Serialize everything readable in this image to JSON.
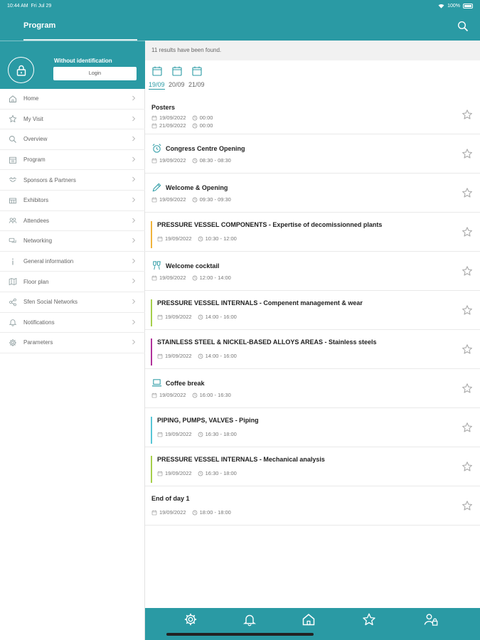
{
  "status_bar": {
    "time": "10:44 AM",
    "date": "Fri Jul 29",
    "battery": "100%"
  },
  "header": {
    "title": "Program",
    "search_icon": "search-icon"
  },
  "user_panel": {
    "identification_text": "Without identification",
    "login_label": "Login",
    "avatar_icon": "lock-icon"
  },
  "menu": {
    "items": [
      {
        "label": "Home",
        "icon": "home-icon"
      },
      {
        "label": "My Visit",
        "icon": "star-icon"
      },
      {
        "label": "Overview",
        "icon": "search-icon"
      },
      {
        "label": "Program",
        "icon": "program-icon"
      },
      {
        "label": "Sponsors & Partners",
        "icon": "handshake-icon"
      },
      {
        "label": "Exhibitors",
        "icon": "exhibitors-icon"
      },
      {
        "label": "Attendees",
        "icon": "attendees-icon"
      },
      {
        "label": "Networking",
        "icon": "chat-icon"
      },
      {
        "label": "General information",
        "icon": "info-icon"
      },
      {
        "label": "Floor plan",
        "icon": "map-icon"
      },
      {
        "label": "Sfen Social Networks",
        "icon": "share-icon"
      },
      {
        "label": "Notifications",
        "icon": "bell-icon"
      },
      {
        "label": "Parameters",
        "icon": "gear-icon"
      }
    ]
  },
  "results_text": "11 results have been found.",
  "date_tabs": [
    {
      "label": "19/09",
      "active": true
    },
    {
      "label": "20/09",
      "active": false
    },
    {
      "label": "21/09",
      "active": false
    }
  ],
  "events": [
    {
      "title": "Posters",
      "date": "19/09/2022",
      "time": "00:00",
      "date2": "21/09/2022",
      "time2": "00:00",
      "icon": null,
      "color": null
    },
    {
      "title": "Congress Centre Opening",
      "date": "19/09/2022",
      "time": "08:30 - 08:30",
      "icon": "alarm-clock-icon",
      "color": null
    },
    {
      "title": "Welcome & Opening",
      "date": "19/09/2022",
      "time": "09:30 - 09:30",
      "icon": "pen-icon",
      "color": null
    },
    {
      "title": "PRESSURE VESSEL COMPONENTS - Expertise of decomissionned plants",
      "date": "19/09/2022",
      "time": "10:30 - 12:00",
      "icon": null,
      "color": "#f0b43c"
    },
    {
      "title": "Welcome cocktail",
      "date": "19/09/2022",
      "time": "12:00 - 14:00",
      "icon": "glasses-icon",
      "color": null
    },
    {
      "title": "PRESSURE VESSEL INTERNALS - Compenent management & wear",
      "date": "19/09/2022",
      "time": "14:00 - 16:00",
      "icon": null,
      "color": "#a6cf4b"
    },
    {
      "title": "STAINLESS STEEL & NICKEL-BASED ALLOYS AREAS - Stainless steels",
      "date": "19/09/2022",
      "time": "14:00 - 16:00",
      "icon": null,
      "color": "#b0329a"
    },
    {
      "title": "Coffee break",
      "date": "19/09/2022",
      "time": "16:00 - 16:30",
      "icon": "laptop-icon",
      "color": null
    },
    {
      "title": "PIPING, PUMPS, VALVES - Piping",
      "date": "19/09/2022",
      "time": "16:30 - 18:00",
      "icon": null,
      "color": "#58c6d6"
    },
    {
      "title": "PRESSURE VESSEL INTERNALS - Mechanical analysis",
      "date": "19/09/2022",
      "time": "16:30 - 18:00",
      "icon": null,
      "color": "#a6cf4b"
    },
    {
      "title": "End of day 1",
      "date": "19/09/2022",
      "time": "18:00 - 18:00",
      "icon": null,
      "color": null
    }
  ],
  "tab_bar": [
    {
      "icon": "gear-icon"
    },
    {
      "icon": "bell-icon"
    },
    {
      "icon": "home-icon"
    },
    {
      "icon": "star-icon"
    },
    {
      "icon": "user-lock-icon"
    }
  ]
}
